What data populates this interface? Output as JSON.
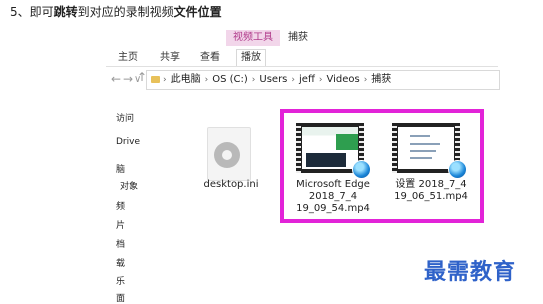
{
  "caption": {
    "prefix": "5、即可",
    "bold1": "跳转",
    "mid": "到对应的录制视频",
    "bold2": "文件位置"
  },
  "ribbon": {
    "context_tab": "视频工具",
    "capture_tab": "捕获",
    "tabs": [
      "主页",
      "共享",
      "查看",
      "播放"
    ]
  },
  "address": {
    "segments": [
      "此电脑",
      "OS (C:)",
      "Users",
      "jeff",
      "Videos",
      "捕获"
    ]
  },
  "nav_pane": {
    "items": [
      "访问",
      "Drive",
      "脑",
      "对象",
      "频",
      "片",
      "档",
      "载",
      "乐",
      "面"
    ]
  },
  "files": [
    {
      "name_lines": [
        "desktop.ini"
      ],
      "icon": "settings-file-icon"
    },
    {
      "name_lines": [
        "Microsoft Edge",
        "2018_7_4",
        "19_09_54.mp4"
      ],
      "icon": "video-file-icon"
    },
    {
      "name_lines": [
        "设置 2018_7_4",
        "19_06_51.mp4"
      ],
      "icon": "video-file-icon"
    }
  ],
  "watermark": "最需教育",
  "colors": {
    "highlight": "#e223d8",
    "context_tab_bg": "#f2d6ea",
    "watermark": "#2f62c9"
  }
}
